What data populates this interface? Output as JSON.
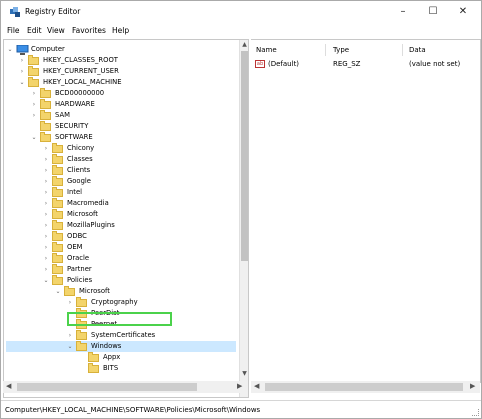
{
  "window": {
    "title": "Registry Editor",
    "controls": [
      "–",
      "☐",
      "✕"
    ]
  },
  "menu": [
    "File",
    "Edit",
    "View",
    "Favorites",
    "Help"
  ],
  "tree": {
    "items": [
      {
        "label": "Computer",
        "icon": "computer-icon",
        "chev": "⌄"
      },
      {
        "label": "HKEY_CLASSES_ROOT",
        "chev": "›"
      },
      {
        "label": "HKEY_CURRENT_USER",
        "chev": "›"
      },
      {
        "label": "HKEY_LOCAL_MACHINE",
        "chev": "⌄"
      },
      {
        "label": "BCD00000000",
        "chev": "›"
      },
      {
        "label": "HARDWARE",
        "chev": "›"
      },
      {
        "label": "SAM",
        "chev": "›"
      },
      {
        "label": "SECURITY",
        "chev": ""
      },
      {
        "label": "SOFTWARE",
        "chev": "⌄"
      },
      {
        "label": "Chicony",
        "chev": "›"
      },
      {
        "label": "Classes",
        "chev": "›"
      },
      {
        "label": "Clients",
        "chev": "›"
      },
      {
        "label": "Google",
        "chev": "›"
      },
      {
        "label": "Intel",
        "chev": "›"
      },
      {
        "label": "Macromedia",
        "chev": "›"
      },
      {
        "label": "Microsoft",
        "chev": "›"
      },
      {
        "label": "MozillaPlugins",
        "chev": "›"
      },
      {
        "label": "ODBC",
        "chev": "›"
      },
      {
        "label": "OEM",
        "chev": "›"
      },
      {
        "label": "Oracle",
        "chev": "›"
      },
      {
        "label": "Partner",
        "chev": "›"
      },
      {
        "label": "Policies",
        "chev": "⌄"
      },
      {
        "label": "Microsoft",
        "chev": "⌄"
      },
      {
        "label": "Cryptography",
        "chev": "›"
      },
      {
        "label": "PeerDist",
        "chev": ""
      },
      {
        "label": "Peernet",
        "chev": ""
      },
      {
        "label": "SystemCertificates",
        "chev": "›"
      },
      {
        "label": "Windows",
        "chev": "⌄"
      },
      {
        "label": "Appx",
        "chev": ""
      },
      {
        "label": "BITS",
        "chev": ""
      }
    ]
  },
  "values": {
    "columns": [
      "Name",
      "Type",
      "Data"
    ],
    "rows": [
      {
        "name": "(Default)",
        "type": "REG_SZ",
        "data": "(value not set)",
        "icon": "string-value-icon"
      }
    ]
  },
  "status": "Computer\\HKEY_LOCAL_MACHINE\\SOFTWARE\\Policies\\Microsoft\\Windows",
  "colors": {
    "highlight": "#4bd24b",
    "folder": "#f3d46b"
  }
}
